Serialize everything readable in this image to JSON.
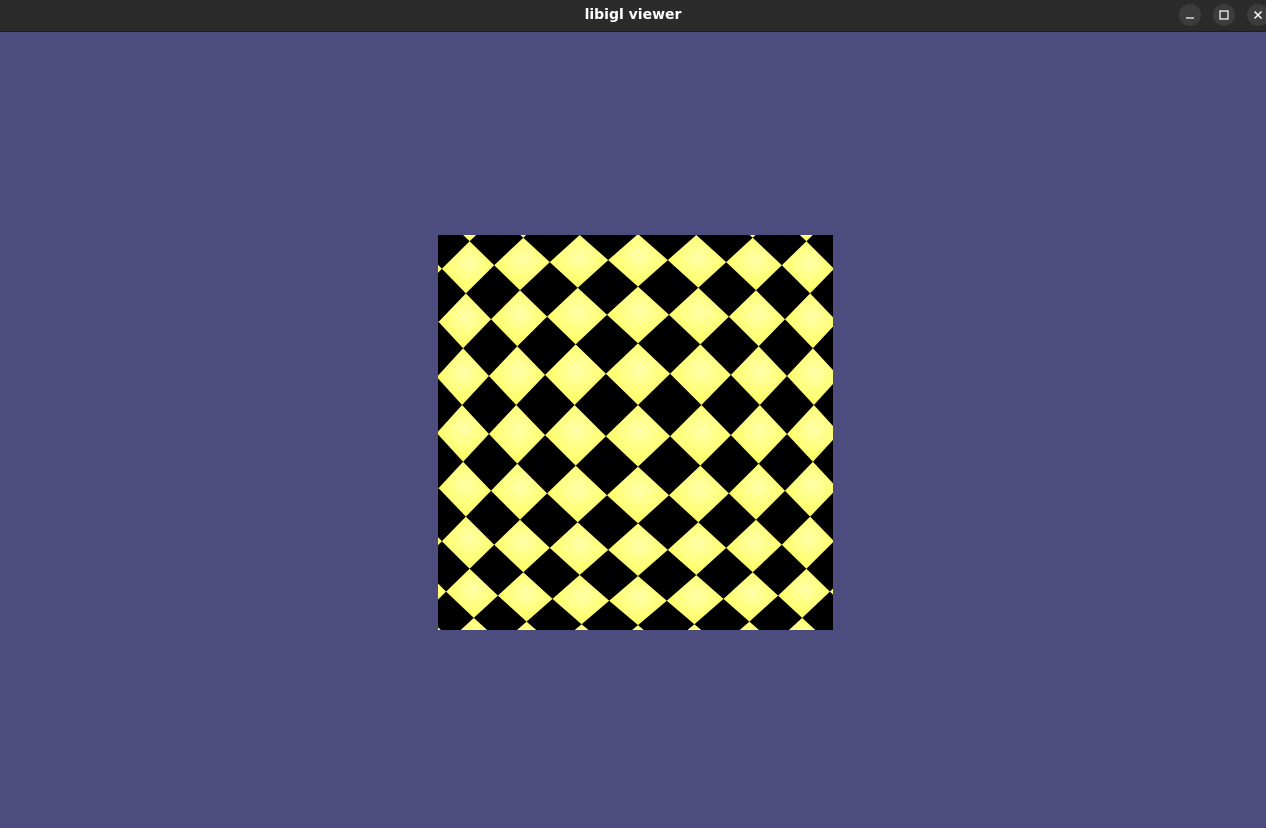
{
  "window": {
    "title": "libigl viewer",
    "controls": {
      "minimize_icon": "minimize-icon",
      "maximize_icon": "maximize-icon",
      "close_icon": "close-icon"
    }
  },
  "viewport": {
    "background_color": "#4d4c7f",
    "mesh": {
      "texture": "checkerboard",
      "colors": {
        "light": "#ffff66",
        "highlight": "#ffff99",
        "dark": "#000000"
      }
    }
  }
}
